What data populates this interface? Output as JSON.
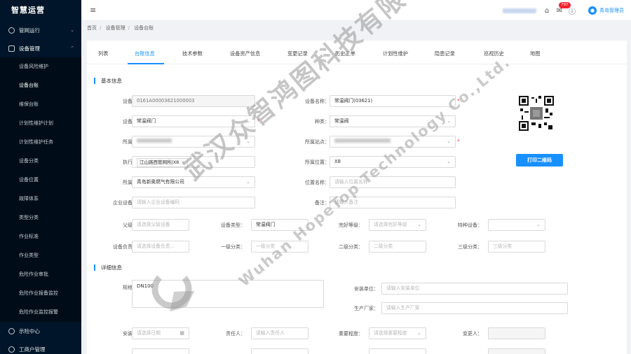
{
  "sidebar": {
    "logo": "智慧运营",
    "groups": [
      {
        "label": "管网运行",
        "arrow": "⌄"
      },
      {
        "label": "设备管理",
        "arrow": "⌃"
      },
      {
        "label": "示险中心"
      },
      {
        "label": "工商户管理"
      }
    ],
    "sub_items": [
      "设备风险维护",
      "设备台账",
      "维保台账",
      "计划性维护计划",
      "计划性维护任务",
      "设备分类",
      "设备位置",
      "故障体系",
      "类型分类",
      "作业标准",
      "作业类型",
      "危险作业审批",
      "危险作业报备监控",
      "危险作业监控报警"
    ]
  },
  "header": {
    "fold_icon": "≡",
    "badge": "797",
    "user": "青岛管理员"
  },
  "breadcrumb": [
    "首页",
    "设备管理",
    "设备台账"
  ],
  "tabs": [
    "列表",
    "台账信息",
    "技术参数",
    "设备资产信息",
    "变更记录",
    "历史工单",
    "计划性维护",
    "隐患记录",
    "巡视历史",
    "地图"
  ],
  "sections": {
    "basic": "基本信息",
    "detail": "详细信息"
  },
  "form": {
    "equip_code_label": "设备编码：",
    "equip_code": "0161A00003621000003",
    "equip_name_label": "设备名称：",
    "equip_name": "常温阀门(03621)",
    "category_label": "设备分类：",
    "category": "常温阀门",
    "kind_label": "种类：",
    "kind": "常温阀",
    "org_label": "所属组织：",
    "station_label": "所属站点：",
    "exec_area_label": "执行区域：",
    "exec_area_tag": "江山路西管网所|X8",
    "location_label": "所属位置：",
    "location": "X8",
    "company_label": "所属公司：",
    "company": "青岛新奥燃气有限公司",
    "pos_name_label": "位置名称：",
    "pos_name_ph": "请输入位置名称",
    "ent_code_label": "企业设备编码：",
    "ent_code_ph": "请输入企业设备编码",
    "remark_label": "备注：",
    "remark_ph": "请输入备注",
    "parent_label": "父级设备：",
    "parent_ph": "请选择父级设备",
    "equip_type_label": "设备类型：",
    "equip_type": "常温阀门",
    "intact_label": "完好等级：",
    "intact_ph": "请选择完好等级",
    "special_label": "特种设备：",
    "owner_label": "设备负责人联：",
    "owner_ph": "请选择设备负责...",
    "level1_label": "一级分类：",
    "level1_ph": "一级分类",
    "level2_label": "二级分类：",
    "level2_ph": "二级分类",
    "level3_label": "三级分类：",
    "level3_ph": "三级分类",
    "spec_label": "规格型号：",
    "spec": "DN100",
    "install_unit_label": "安装单位：",
    "install_unit_ph": "请输入安装单位",
    "maker_label": "生产厂家：",
    "maker_ph": "请输入生产厂家",
    "install_date_label": "安装日期：",
    "install_date_ph": "请选择日期",
    "person_label": "责任人：",
    "person_ph": "请输入责任人",
    "importance_label": "重要程度：",
    "importance_ph": "请选择重要程度",
    "changer_label": "变更人："
  },
  "print_btn": "打印二维码",
  "watermark": {
    "main": "武汉众智鸿图科技有限公司",
    "sub": "Wuhan HopeTop Technology Co.,Ltd."
  }
}
